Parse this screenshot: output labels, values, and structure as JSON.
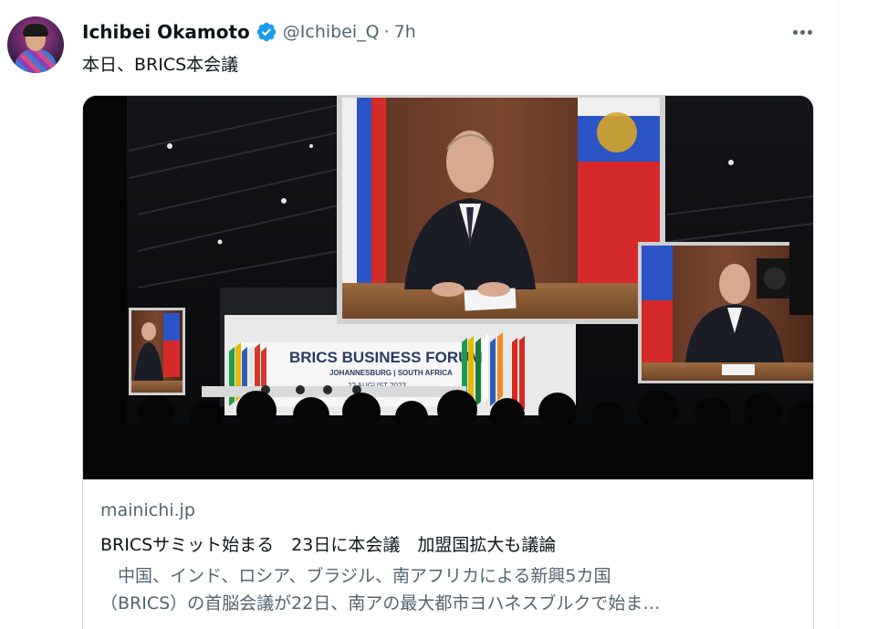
{
  "author": {
    "display_name": "Ichibei Okamoto",
    "handle": "@Ichibei_Q",
    "separator": "·",
    "time": "7h",
    "verified": true
  },
  "tweet": {
    "text": "本日、BRICS本会議"
  },
  "card": {
    "domain": "mainichi.jp",
    "title": "BRICSサミット始まる　23日に本会議　加盟国拡大も議論",
    "description_line1": "　中国、インド、ロシア、ブラジル、南アフリカによる新興5カ国",
    "description_line2": "（BRICS）の首脳会議が22日、南アの最大都市ヨハネスブルクで始ま…",
    "image": {
      "banner_title": "BRICS BUSINESS FORUM",
      "banner_subtitle": "JOHANNESBURG | SOUTH AFRICA",
      "banner_date": "22 AUGUST 2023"
    }
  },
  "icons": {
    "verified": "verified-badge-icon",
    "more": "more-options-icon"
  },
  "colors": {
    "verified_blue": "#1d9bf0",
    "text_primary": "#0f1419",
    "text_secondary": "#536471",
    "border": "#cfd9de"
  }
}
